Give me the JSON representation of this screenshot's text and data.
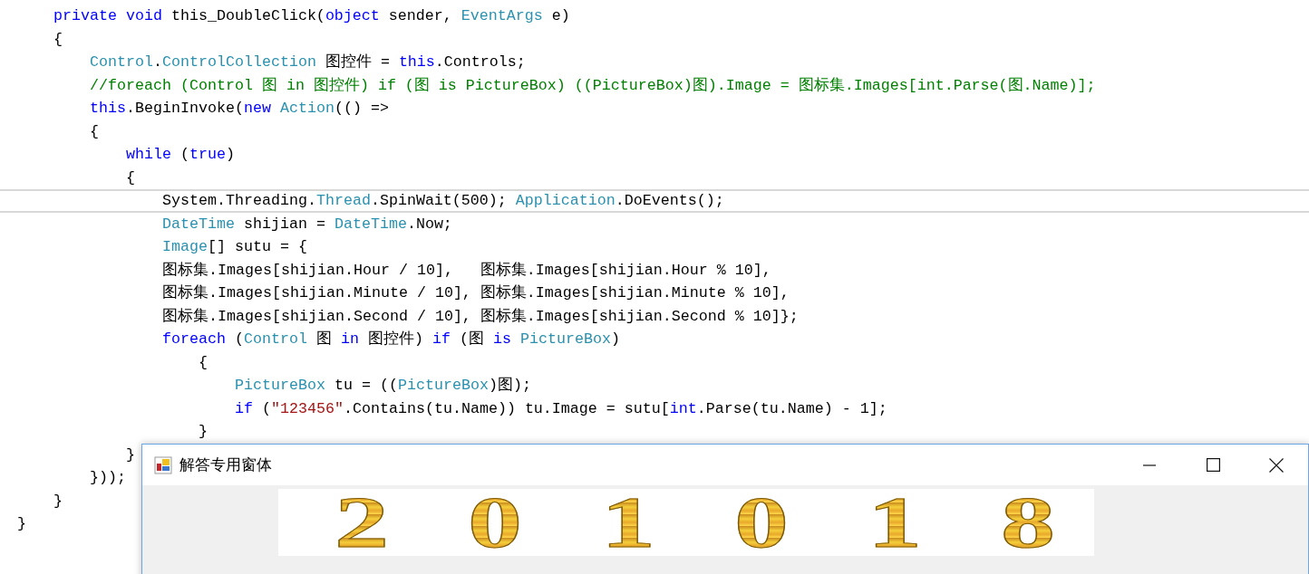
{
  "code_lines": [
    {
      "current": false,
      "tokens": [
        {
          "t": "private ",
          "kind": "kw"
        },
        {
          "t": "void",
          "kind": "kw"
        },
        {
          "t": " this_DoubleClick(",
          "kind": "plain"
        },
        {
          "t": "object",
          "kind": "kw"
        },
        {
          "t": " sender, ",
          "kind": "plain"
        },
        {
          "t": "EventArgs",
          "kind": "type"
        },
        {
          "t": " e)",
          "kind": "plain"
        }
      ]
    },
    {
      "current": false,
      "tokens": [
        {
          "t": "{",
          "kind": "plain"
        }
      ],
      "children": [
        {
          "current": false,
          "tokens": [
            {
              "t": "Control",
              "kind": "type"
            },
            {
              "t": ".",
              "kind": "plain"
            },
            {
              "t": "ControlCollection",
              "kind": "type"
            },
            {
              "t": " 图控件 = ",
              "kind": "plain"
            },
            {
              "t": "this",
              "kind": "kw"
            },
            {
              "t": ".Controls;",
              "kind": "plain"
            }
          ]
        },
        {
          "current": false,
          "tokens": [
            {
              "t": "//foreach (Control 图 in 图控件) if (图 is PictureBox) ((PictureBox)图).Image = 图标集.Images[int.Parse(图.Name)];",
              "kind": "comment"
            }
          ]
        },
        {
          "current": false,
          "tokens": [
            {
              "t": "this",
              "kind": "kw"
            },
            {
              "t": ".BeginInvoke(",
              "kind": "plain"
            },
            {
              "t": "new ",
              "kind": "kw"
            },
            {
              "t": "Action",
              "kind": "type"
            },
            {
              "t": "(() =>",
              "kind": "plain"
            }
          ]
        },
        {
          "current": false,
          "tokens": [
            {
              "t": "{",
              "kind": "plain"
            }
          ],
          "children": [
            {
              "current": false,
              "tokens": [
                {
                  "t": "while",
                  "kind": "kw"
                },
                {
                  "t": " (",
                  "kind": "plain"
                },
                {
                  "t": "true",
                  "kind": "kw"
                },
                {
                  "t": ")",
                  "kind": "plain"
                }
              ]
            },
            {
              "current": false,
              "tokens": [
                {
                  "t": "{",
                  "kind": "plain"
                }
              ],
              "children": [
                {
                  "current": true,
                  "tokens": [
                    {
                      "t": "System.Threading.",
                      "kind": "plain"
                    },
                    {
                      "t": "Thread",
                      "kind": "type"
                    },
                    {
                      "t": ".SpinWait(500); ",
                      "kind": "plain"
                    },
                    {
                      "t": "Application",
                      "kind": "type"
                    },
                    {
                      "t": ".DoEvents();",
                      "kind": "plain"
                    }
                  ]
                },
                {
                  "current": false,
                  "tokens": [
                    {
                      "t": "DateTime",
                      "kind": "type"
                    },
                    {
                      "t": " shijian = ",
                      "kind": "plain"
                    },
                    {
                      "t": "DateTime",
                      "kind": "type"
                    },
                    {
                      "t": ".Now;",
                      "kind": "plain"
                    }
                  ]
                },
                {
                  "current": false,
                  "tokens": [
                    {
                      "t": "Image",
                      "kind": "type"
                    },
                    {
                      "t": "[] sutu = {",
                      "kind": "plain"
                    }
                  ]
                },
                {
                  "current": false,
                  "tokens": [
                    {
                      "t": "图标集.Images[shijian.Hour / 10],   图标集.Images[shijian.Hour % 10],",
                      "kind": "plain"
                    }
                  ]
                },
                {
                  "current": false,
                  "tokens": [
                    {
                      "t": "图标集.Images[shijian.Minute / 10], 图标集.Images[shijian.Minute % 10],",
                      "kind": "plain"
                    }
                  ]
                },
                {
                  "current": false,
                  "tokens": [
                    {
                      "t": "图标集.Images[shijian.Second / 10], 图标集.Images[shijian.Second % 10]};",
                      "kind": "plain"
                    }
                  ]
                },
                {
                  "current": false,
                  "tokens": [
                    {
                      "t": "foreach",
                      "kind": "kw"
                    },
                    {
                      "t": " (",
                      "kind": "plain"
                    },
                    {
                      "t": "Control",
                      "kind": "type"
                    },
                    {
                      "t": " 图 ",
                      "kind": "plain"
                    },
                    {
                      "t": "in",
                      "kind": "kw"
                    },
                    {
                      "t": " 图控件) ",
                      "kind": "plain"
                    },
                    {
                      "t": "if",
                      "kind": "kw"
                    },
                    {
                      "t": " (图 ",
                      "kind": "plain"
                    },
                    {
                      "t": "is ",
                      "kind": "kw"
                    },
                    {
                      "t": "PictureBox",
                      "kind": "type"
                    },
                    {
                      "t": ")",
                      "kind": "plain"
                    }
                  ],
                  "children": [
                    {
                      "current": false,
                      "tokens": [
                        {
                          "t": "{",
                          "kind": "plain"
                        }
                      ],
                      "children": [
                        {
                          "current": false,
                          "tokens": [
                            {
                              "t": "PictureBox",
                              "kind": "type"
                            },
                            {
                              "t": " tu = ((",
                              "kind": "plain"
                            },
                            {
                              "t": "PictureBox",
                              "kind": "type"
                            },
                            {
                              "t": ")图);",
                              "kind": "plain"
                            }
                          ]
                        },
                        {
                          "current": false,
                          "tokens": [
                            {
                              "t": "if",
                              "kind": "kw"
                            },
                            {
                              "t": " (",
                              "kind": "plain"
                            },
                            {
                              "t": "\"123456\"",
                              "kind": "string"
                            },
                            {
                              "t": ".Contains(tu.Name)) tu.Image = sutu[",
                              "kind": "plain"
                            },
                            {
                              "t": "int",
                              "kind": "kw"
                            },
                            {
                              "t": ".Parse(tu.Name) - 1];",
                              "kind": "plain"
                            }
                          ]
                        }
                      ]
                    },
                    {
                      "current": false,
                      "tokens": [
                        {
                          "t": "}",
                          "kind": "plain"
                        }
                      ]
                    }
                  ]
                }
              ]
            },
            {
              "current": false,
              "tokens": [
                {
                  "t": "}",
                  "kind": "plain"
                }
              ]
            }
          ]
        },
        {
          "current": false,
          "tokens": [
            {
              "t": "}));",
              "kind": "plain"
            }
          ]
        }
      ]
    },
    {
      "current": false,
      "tokens": [
        {
          "t": "}",
          "kind": "plain"
        }
      ]
    }
  ],
  "closing_line": {
    "current": false,
    "tokens": [
      {
        "t": "}",
        "kind": "plain"
      }
    ]
  },
  "window": {
    "title": "解答专用窗体",
    "digits": [
      "2",
      "0",
      "1",
      "0",
      "1",
      "8"
    ]
  }
}
